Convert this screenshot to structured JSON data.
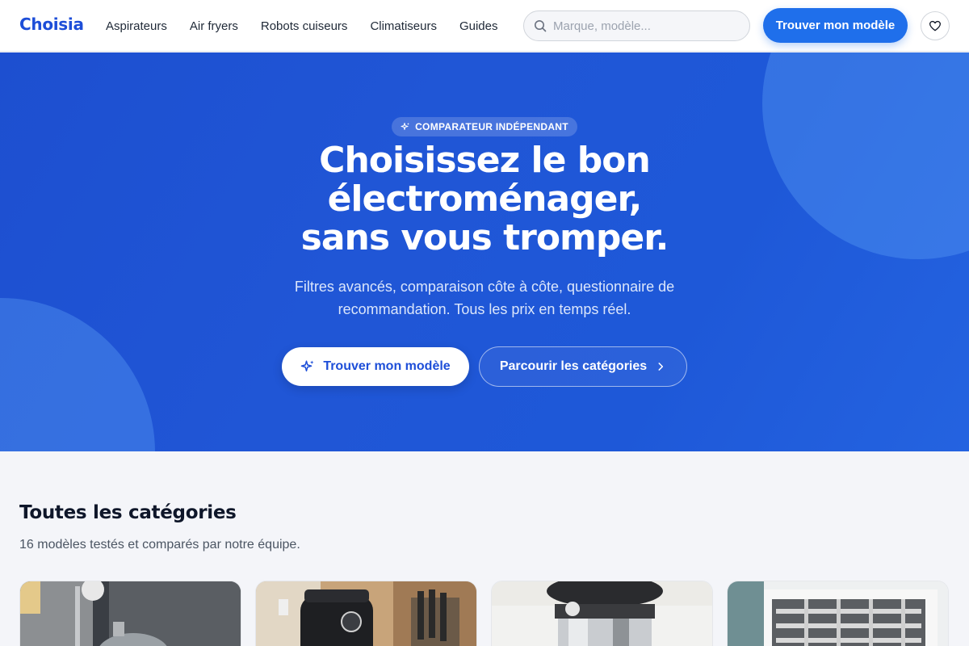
{
  "header": {
    "logo": "Choisia",
    "nav": [
      "Aspirateurs",
      "Air fryers",
      "Robots cuiseurs",
      "Climatiseurs",
      "Guides"
    ],
    "search_placeholder": "Marque, modèle...",
    "cta_label": "Trouver mon modèle",
    "favorites_icon": "heart-icon"
  },
  "hero": {
    "badge": "COMPARATEUR INDÉPENDANT",
    "title_lines": [
      "Choisissez le bon",
      "électroménager,",
      "sans vous tromper."
    ],
    "subtitle": "Filtres avancés, comparaison côte à côte, questionnaire de recommandation. Tous les prix en temps réel.",
    "primary_button": "Trouver mon modèle",
    "secondary_button": "Parcourir les catégories"
  },
  "categories": {
    "title": "Toutes les catégories",
    "subtitle": "16 modèles testés et comparés par notre équipe."
  },
  "colors": {
    "brand": "#1d4ed8",
    "cta": "#1f6feb",
    "hero_bg": "#1e56d6",
    "page_bg": "#f4f5f9"
  }
}
